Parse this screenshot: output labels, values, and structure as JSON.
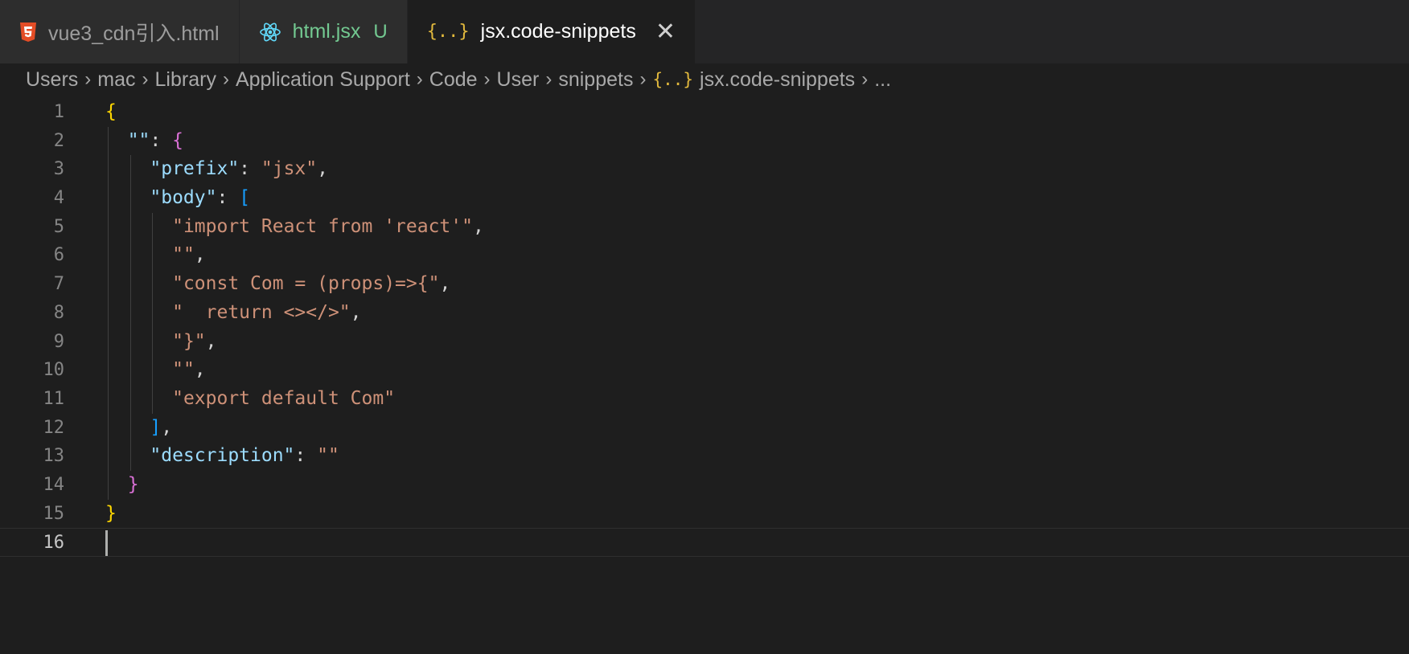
{
  "tabs": [
    {
      "label": "vue3_cdn引入.html",
      "icon": "html5-icon",
      "active": false
    },
    {
      "label": "html.jsx",
      "icon": "react-icon",
      "badge": "U",
      "active": false
    },
    {
      "label": "jsx.code-snippets",
      "icon": "json-braces-icon",
      "icon_text": "{..}",
      "active": true,
      "close": "✕"
    }
  ],
  "breadcrumb": {
    "items": [
      "Users",
      "mac",
      "Library",
      "Application Support",
      "Code",
      "User",
      "snippets"
    ],
    "file_icon": "{..}",
    "file": "jsx.code-snippets",
    "trailing": "...",
    "separator": "›"
  },
  "editor": {
    "lines": [
      {
        "n": "1",
        "tokens": [
          {
            "t": "{",
            "c": "b1"
          }
        ]
      },
      {
        "n": "2",
        "tokens": [
          {
            "t": "  "
          },
          {
            "t": "\"\"",
            "c": "key"
          },
          {
            "t": ": ",
            "c": "pun"
          },
          {
            "t": "{",
            "c": "b2"
          }
        ]
      },
      {
        "n": "3",
        "tokens": [
          {
            "t": "    "
          },
          {
            "t": "\"prefix\"",
            "c": "key"
          },
          {
            "t": ": ",
            "c": "pun"
          },
          {
            "t": "\"jsx\"",
            "c": "str"
          },
          {
            "t": ",",
            "c": "pun"
          }
        ]
      },
      {
        "n": "4",
        "tokens": [
          {
            "t": "    "
          },
          {
            "t": "\"body\"",
            "c": "key"
          },
          {
            "t": ": ",
            "c": "pun"
          },
          {
            "t": "[",
            "c": "b3"
          }
        ]
      },
      {
        "n": "5",
        "tokens": [
          {
            "t": "      "
          },
          {
            "t": "\"import React from 'react'\"",
            "c": "str"
          },
          {
            "t": ",",
            "c": "pun"
          }
        ]
      },
      {
        "n": "6",
        "tokens": [
          {
            "t": "      "
          },
          {
            "t": "\"\"",
            "c": "str"
          },
          {
            "t": ",",
            "c": "pun"
          }
        ]
      },
      {
        "n": "7",
        "tokens": [
          {
            "t": "      "
          },
          {
            "t": "\"const Com = (props)=>{\"",
            "c": "str"
          },
          {
            "t": ",",
            "c": "pun"
          }
        ]
      },
      {
        "n": "8",
        "tokens": [
          {
            "t": "      "
          },
          {
            "t": "\"  return <></>\"",
            "c": "str"
          },
          {
            "t": ",",
            "c": "pun"
          }
        ]
      },
      {
        "n": "9",
        "tokens": [
          {
            "t": "      "
          },
          {
            "t": "\"}\"",
            "c": "str"
          },
          {
            "t": ",",
            "c": "pun"
          }
        ]
      },
      {
        "n": "10",
        "tokens": [
          {
            "t": "      "
          },
          {
            "t": "\"\"",
            "c": "str"
          },
          {
            "t": ",",
            "c": "pun"
          }
        ]
      },
      {
        "n": "11",
        "tokens": [
          {
            "t": "      "
          },
          {
            "t": "\"export default Com\"",
            "c": "str"
          }
        ]
      },
      {
        "n": "12",
        "tokens": [
          {
            "t": "    "
          },
          {
            "t": "]",
            "c": "b3"
          },
          {
            "t": ",",
            "c": "pun"
          }
        ]
      },
      {
        "n": "13",
        "tokens": [
          {
            "t": "    "
          },
          {
            "t": "\"description\"",
            "c": "key"
          },
          {
            "t": ": ",
            "c": "pun"
          },
          {
            "t": "\"\"",
            "c": "str"
          }
        ]
      },
      {
        "n": "14",
        "tokens": [
          {
            "t": "  "
          },
          {
            "t": "}",
            "c": "b2"
          }
        ]
      },
      {
        "n": "15",
        "tokens": [
          {
            "t": "}",
            "c": "b1"
          }
        ]
      },
      {
        "n": "16",
        "tokens": [],
        "current": true
      }
    ]
  },
  "colors": {
    "background": "#1e1e1e",
    "tabbar": "#252526",
    "bracket_level1": "#ffd700",
    "bracket_level2": "#da70d6",
    "bracket_level3": "#179fff",
    "json_key": "#9cdcfe",
    "string": "#ce9178",
    "untracked_badge": "#73c991"
  }
}
